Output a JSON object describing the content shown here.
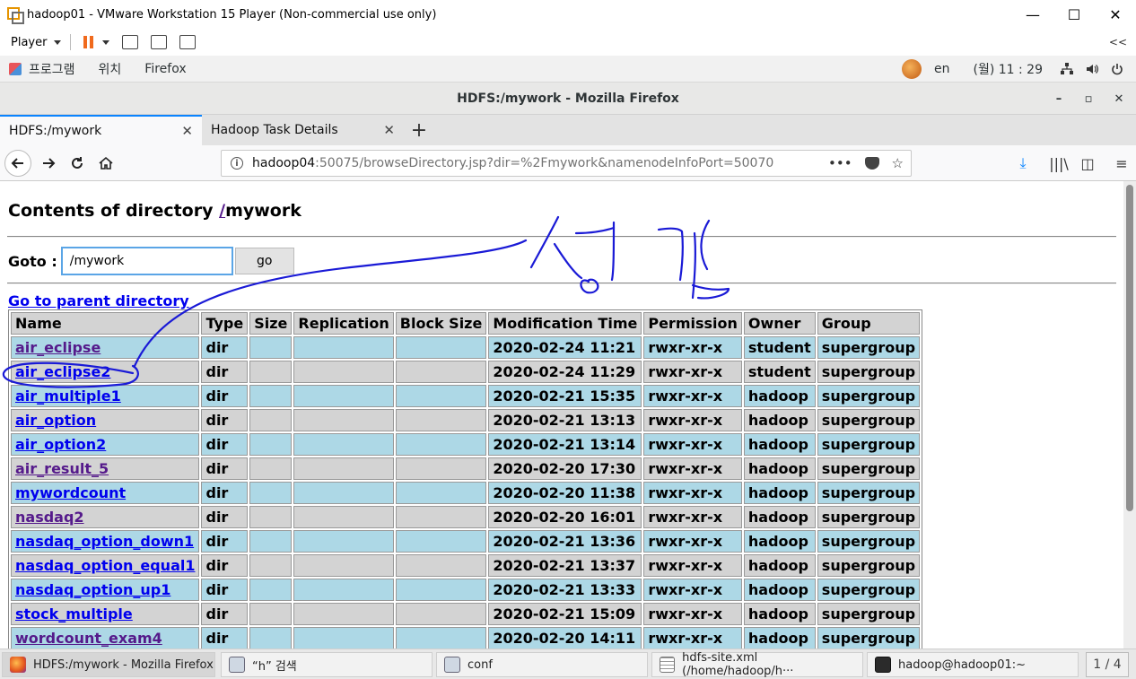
{
  "vmware": {
    "title": "hadoop01 - VMware Workstation 15 Player (Non-commercial use only)",
    "player_label": "Player",
    "minimize": "—",
    "maximize": "☐",
    "close": "✕",
    "collapse": "<<"
  },
  "gnome": {
    "menu": [
      "프로그램",
      "위치",
      "Firefox"
    ],
    "lang": "en",
    "clock": "(월) 11 : 29"
  },
  "firefox": {
    "window_title": "HDFS:/mywork - Mozilla Firefox",
    "win_min": "–",
    "win_max": "▫",
    "win_close": "✕",
    "tabs": [
      {
        "label": "HDFS:/mywork",
        "active": true
      },
      {
        "label": "Hadoop Task Details",
        "active": false
      }
    ],
    "url_host": "hadoop04",
    "url_rest": ":50075/browseDirectory.jsp?dir=%2Fmywork&namenodeInfoPort=50070",
    "url_more": "•••"
  },
  "page": {
    "heading_prefix": "Contents of directory ",
    "heading_root": "/",
    "heading_dir": "mywork",
    "goto_label": "Goto :",
    "goto_value": "/mywork",
    "go_button": "go",
    "parent_link": "Go to parent directory",
    "columns": [
      "Name",
      "Type",
      "Size",
      "Replication",
      "Block Size",
      "Modification Time",
      "Permission",
      "Owner",
      "Group"
    ],
    "rows": [
      {
        "name": "air_eclipse",
        "visited": true,
        "type": "dir",
        "size": "",
        "replication": "",
        "block_size": "",
        "mtime": "2020-02-24 11:21",
        "perm": "rwxr-xr-x",
        "owner": "student",
        "group": "supergroup"
      },
      {
        "name": "air_eclipse2",
        "visited": false,
        "type": "dir",
        "size": "",
        "replication": "",
        "block_size": "",
        "mtime": "2020-02-24 11:29",
        "perm": "rwxr-xr-x",
        "owner": "student",
        "group": "supergroup"
      },
      {
        "name": "air_multiple1",
        "visited": false,
        "type": "dir",
        "size": "",
        "replication": "",
        "block_size": "",
        "mtime": "2020-02-21 15:35",
        "perm": "rwxr-xr-x",
        "owner": "hadoop",
        "group": "supergroup"
      },
      {
        "name": "air_option",
        "visited": false,
        "type": "dir",
        "size": "",
        "replication": "",
        "block_size": "",
        "mtime": "2020-02-21 13:13",
        "perm": "rwxr-xr-x",
        "owner": "hadoop",
        "group": "supergroup"
      },
      {
        "name": "air_option2",
        "visited": false,
        "type": "dir",
        "size": "",
        "replication": "",
        "block_size": "",
        "mtime": "2020-02-21 13:14",
        "perm": "rwxr-xr-x",
        "owner": "hadoop",
        "group": "supergroup"
      },
      {
        "name": "air_result_5",
        "visited": true,
        "type": "dir",
        "size": "",
        "replication": "",
        "block_size": "",
        "mtime": "2020-02-20 17:30",
        "perm": "rwxr-xr-x",
        "owner": "hadoop",
        "group": "supergroup"
      },
      {
        "name": "mywordcount",
        "visited": false,
        "type": "dir",
        "size": "",
        "replication": "",
        "block_size": "",
        "mtime": "2020-02-20 11:38",
        "perm": "rwxr-xr-x",
        "owner": "hadoop",
        "group": "supergroup"
      },
      {
        "name": "nasdaq2",
        "visited": true,
        "type": "dir",
        "size": "",
        "replication": "",
        "block_size": "",
        "mtime": "2020-02-20 16:01",
        "perm": "rwxr-xr-x",
        "owner": "hadoop",
        "group": "supergroup"
      },
      {
        "name": "nasdaq_option_down1",
        "visited": false,
        "type": "dir",
        "size": "",
        "replication": "",
        "block_size": "",
        "mtime": "2020-02-21 13:36",
        "perm": "rwxr-xr-x",
        "owner": "hadoop",
        "group": "supergroup"
      },
      {
        "name": "nasdaq_option_equal1",
        "visited": false,
        "type": "dir",
        "size": "",
        "replication": "",
        "block_size": "",
        "mtime": "2020-02-21 13:37",
        "perm": "rwxr-xr-x",
        "owner": "hadoop",
        "group": "supergroup"
      },
      {
        "name": "nasdaq_option_up1",
        "visited": false,
        "type": "dir",
        "size": "",
        "replication": "",
        "block_size": "",
        "mtime": "2020-02-21 13:33",
        "perm": "rwxr-xr-x",
        "owner": "hadoop",
        "group": "supergroup"
      },
      {
        "name": "stock_multiple",
        "visited": false,
        "type": "dir",
        "size": "",
        "replication": "",
        "block_size": "",
        "mtime": "2020-02-21 15:09",
        "perm": "rwxr-xr-x",
        "owner": "hadoop",
        "group": "supergroup"
      },
      {
        "name": "wordcount_exam4",
        "visited": true,
        "type": "dir",
        "size": "",
        "replication": "",
        "block_size": "",
        "mtime": "2020-02-20 14:11",
        "perm": "rwxr-xr-x",
        "owner": "hadoop",
        "group": "supergroup"
      }
    ]
  },
  "taskbar": {
    "items": [
      {
        "label": "HDFS:/mywork - Mozilla Firefox",
        "icon": "firefox-icon",
        "active": true
      },
      {
        "label": "“h” 검색",
        "icon": "file-manager-icon",
        "active": false
      },
      {
        "label": "conf",
        "icon": "file-manager-icon",
        "active": false
      },
      {
        "label": "hdfs-site.xml (/home/hadoop/h···",
        "icon": "text-editor-icon",
        "active": false
      },
      {
        "label": "hadoop@hadoop01:~",
        "icon": "terminal-icon",
        "active": false
      }
    ],
    "pager": "1 / 4"
  },
  "colors": {
    "row_blue": "#add8e6",
    "row_gray": "#d3d3d3",
    "link_unvisited": "#0000ee",
    "link_visited": "#551a8b",
    "annotation_ink": "#1a1ad6",
    "accent": "#0a84ff"
  }
}
